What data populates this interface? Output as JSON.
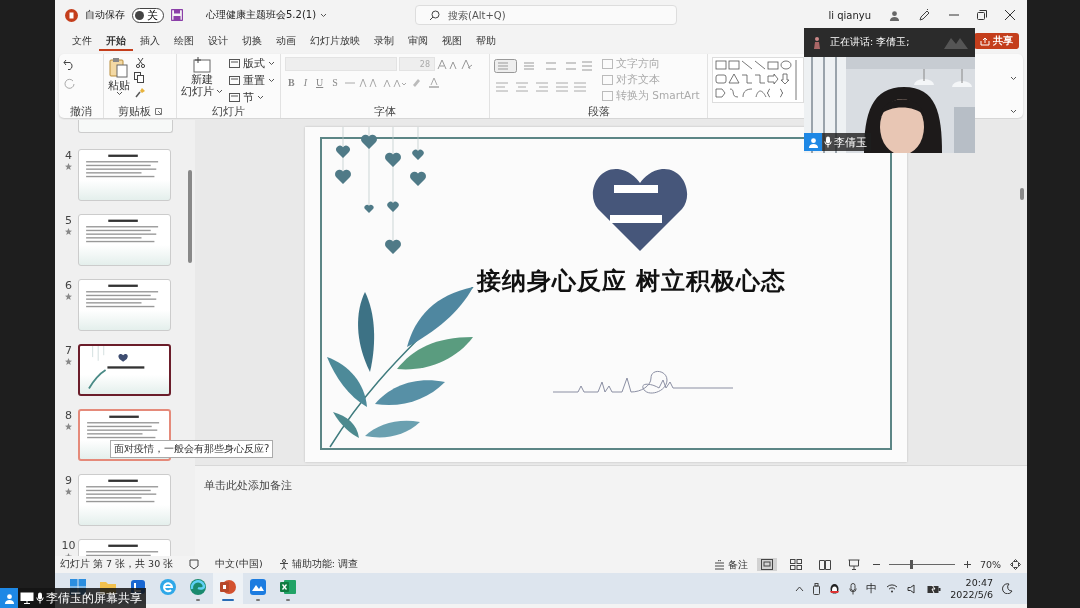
{
  "window": {
    "autosave_label": "自动保存",
    "autosave": {
      "on": false,
      "label": "关"
    },
    "file_name": "心理健康主题班会5.2(1)",
    "search": {
      "placeholder": "搜索(Alt+Q)"
    },
    "user": "li qianyu"
  },
  "menu_tabs": [
    {
      "label": "文件",
      "selected": false
    },
    {
      "label": "开始",
      "selected": true
    },
    {
      "label": "插入",
      "selected": false
    },
    {
      "label": "绘图",
      "selected": false
    },
    {
      "label": "设计",
      "selected": false
    },
    {
      "label": "切换",
      "selected": false
    },
    {
      "label": "动画",
      "selected": false
    },
    {
      "label": "幻灯片放映",
      "selected": false
    },
    {
      "label": "录制",
      "selected": false
    },
    {
      "label": "审阅",
      "selected": false
    },
    {
      "label": "视图",
      "selected": false
    },
    {
      "label": "帮助",
      "selected": false
    }
  ],
  "share_button": "共享",
  "ribbon": {
    "undo": {
      "label": "撤消"
    },
    "clipboard": {
      "label": "剪贴板",
      "paste": "粘贴"
    },
    "slides": {
      "label": "幻灯片",
      "new_slide": [
        "新建",
        "幻灯片"
      ],
      "items": [
        "版式",
        "重置",
        "节"
      ]
    },
    "font": {
      "label": "字体",
      "size": "28",
      "styles": [
        "B",
        "I",
        "U",
        "S"
      ]
    },
    "paragraph": {
      "label": "段落",
      "items": [
        {
          "label": "文字方向",
          "disabled": true
        },
        {
          "label": "对齐文本",
          "disabled": true
        },
        {
          "label": "转换为 SmartArt",
          "disabled": true
        }
      ]
    }
  },
  "thumbnails": [
    {
      "number": "4",
      "kind": "text",
      "selected": false,
      "hovered": false
    },
    {
      "number": "5",
      "kind": "text",
      "selected": false,
      "hovered": false
    },
    {
      "number": "6",
      "kind": "text",
      "selected": false,
      "hovered": false
    },
    {
      "number": "7",
      "kind": "title",
      "selected": true,
      "hovered": false
    },
    {
      "number": "8",
      "kind": "text",
      "selected": false,
      "hovered": true
    },
    {
      "number": "9",
      "kind": "text",
      "selected": false,
      "hovered": false
    },
    {
      "number": "10",
      "kind": "text",
      "selected": false,
      "hovered": false
    }
  ],
  "tooltip": "面对疫情，一般会有那些身心反应?",
  "slide": {
    "title": "接纳身心反应 树立积极心态"
  },
  "notes_placeholder": "单击此处添加备注",
  "video": {
    "speaking_label": "正在讲话: 李倩玉;",
    "name": "李倩玉"
  },
  "status_bar": {
    "slide_info": "幻灯片 第 7 张，共 30 张",
    "language": "中文(中国)",
    "accessibility": "辅助功能: 调查",
    "notes": "备注",
    "views": [
      {
        "kind": "normal",
        "selected": true
      },
      {
        "kind": "sorter",
        "selected": false
      },
      {
        "kind": "reading",
        "selected": false
      },
      {
        "kind": "slideshow",
        "selected": false
      }
    ],
    "zoom": {
      "level": 0.34,
      "percent": "70%"
    }
  },
  "taskbar": {
    "apps": [
      {
        "kind": "start",
        "running": false,
        "active": false
      },
      {
        "kind": "folder",
        "running": false,
        "active": false
      },
      {
        "kind": "store",
        "running": false,
        "active": false
      },
      {
        "kind": "ie",
        "running": false,
        "active": false
      },
      {
        "kind": "edge",
        "running": true,
        "active": false
      },
      {
        "kind": "powerpoint",
        "running": true,
        "active": true
      },
      {
        "kind": "cloud",
        "running": true,
        "active": false
      },
      {
        "kind": "excel",
        "running": true,
        "active": false
      }
    ],
    "ime": "中",
    "time": "20:47",
    "date": "2022/5/6"
  },
  "screen_share": {
    "label": "李倩玉的屏幕共享"
  }
}
